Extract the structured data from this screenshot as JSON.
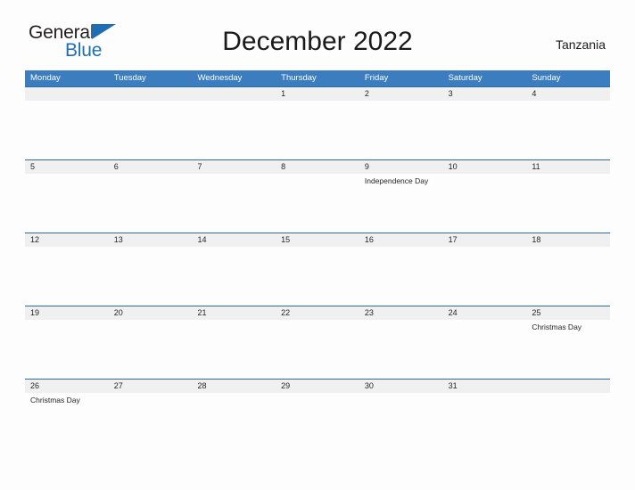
{
  "brand": {
    "name_part1": "General",
    "name_part2": "Blue"
  },
  "header": {
    "title": "December 2022",
    "country": "Tanzania"
  },
  "calendar": {
    "weekdays": [
      "Monday",
      "Tuesday",
      "Wednesday",
      "Thursday",
      "Friday",
      "Saturday",
      "Sunday"
    ],
    "colors": {
      "header_blue": "#3b7dbf",
      "row_border_blue": "#2b6ca3",
      "date_strip_gray": "#f0f0f0",
      "brand_blue": "#1f6eb5",
      "text_dark": "#262626"
    },
    "weeks": [
      {
        "dates": [
          "",
          "",
          "",
          "1",
          "2",
          "3",
          "4"
        ],
        "events": [
          "",
          "",
          "",
          "",
          "",
          "",
          ""
        ]
      },
      {
        "dates": [
          "5",
          "6",
          "7",
          "8",
          "9",
          "10",
          "11"
        ],
        "events": [
          "",
          "",
          "",
          "",
          "Independence Day",
          "",
          ""
        ]
      },
      {
        "dates": [
          "12",
          "13",
          "14",
          "15",
          "16",
          "17",
          "18"
        ],
        "events": [
          "",
          "",
          "",
          "",
          "",
          "",
          ""
        ]
      },
      {
        "dates": [
          "19",
          "20",
          "21",
          "22",
          "23",
          "24",
          "25"
        ],
        "events": [
          "",
          "",
          "",
          "",
          "",
          "",
          "Christmas Day"
        ]
      },
      {
        "dates": [
          "26",
          "27",
          "28",
          "29",
          "30",
          "31",
          ""
        ],
        "events": [
          "Christmas Day",
          "",
          "",
          "",
          "",
          "",
          ""
        ]
      }
    ]
  }
}
